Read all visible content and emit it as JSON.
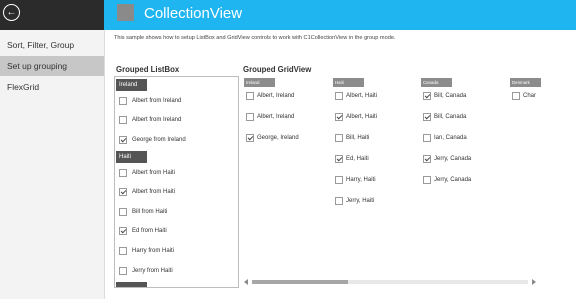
{
  "nav": {
    "items": [
      {
        "label": "Sort, Filter, Group",
        "selected": false
      },
      {
        "label": "Set up grouping",
        "selected": true
      },
      {
        "label": "FlexGrid",
        "selected": false
      }
    ]
  },
  "header": {
    "title": "CollectionView"
  },
  "description": "This sample shows how to setup ListBox and GridView controls to work with C1CollectionView in the group mode.",
  "listbox": {
    "title": "Grouped ListBox",
    "groups": [
      {
        "name": "Ireland",
        "items": [
          {
            "label": "Albert from Ireland",
            "checked": false
          },
          {
            "label": "Albert from Ireland",
            "checked": false
          },
          {
            "label": "George from Ireland",
            "checked": true
          }
        ]
      },
      {
        "name": "Haiti",
        "items": [
          {
            "label": "Albert from Haiti",
            "checked": false
          },
          {
            "label": "Albert from Haiti",
            "checked": true
          },
          {
            "label": "Bill from Haiti",
            "checked": false
          },
          {
            "label": "Ed from Haiti",
            "checked": true
          },
          {
            "label": "Harry from Haiti",
            "checked": false
          },
          {
            "label": "Jerry from Haiti",
            "checked": false
          }
        ]
      }
    ]
  },
  "gridview": {
    "title": "Grouped GridView",
    "groups": [
      {
        "name": "Ireland",
        "items": [
          {
            "label": "Albert, Ireland",
            "checked": false
          },
          {
            "label": "Albert, Ireland",
            "checked": false
          },
          {
            "label": "George, Ireland",
            "checked": true
          }
        ]
      },
      {
        "name": "Haiti",
        "items": [
          {
            "label": "Albert, Haiti",
            "checked": false
          },
          {
            "label": "Albert, Haiti",
            "checked": true
          },
          {
            "label": "Bill, Haiti",
            "checked": false
          },
          {
            "label": "Ed, Haiti",
            "checked": true
          },
          {
            "label": "Harry, Haiti",
            "checked": false
          },
          {
            "label": "Jerry, Haiti",
            "checked": false
          }
        ]
      },
      {
        "name": "Canada",
        "items": [
          {
            "label": "Bill, Canada",
            "checked": true
          },
          {
            "label": "Bill, Canada",
            "checked": true
          },
          {
            "label": "Ian, Canada",
            "checked": false
          },
          {
            "label": "Jerry, Canada",
            "checked": true
          },
          {
            "label": "Jerry, Canada",
            "checked": false
          }
        ]
      },
      {
        "name": "Denmark",
        "items": [
          {
            "label": "Char",
            "checked": false
          }
        ]
      }
    ]
  },
  "icons": {
    "back": "back-arrow-icon",
    "app": "app-tile-icon"
  },
  "colors": {
    "accent": "#1fb5f0",
    "dark": "#2b2b2b",
    "group_header": "#555555"
  }
}
